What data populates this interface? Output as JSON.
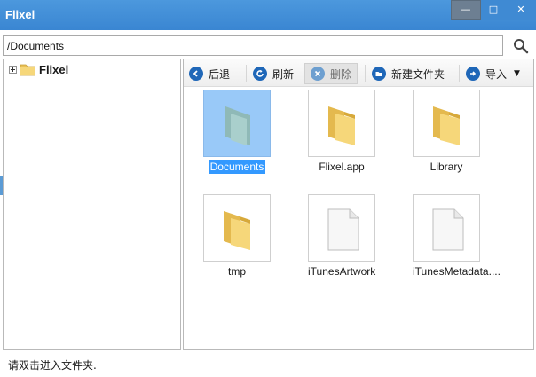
{
  "window": {
    "title": "Flixel",
    "controls": {
      "minimize": "—",
      "maximize": "□",
      "close": "✕"
    }
  },
  "address": {
    "value": "/Documents"
  },
  "tree": {
    "root_label": "Flixel"
  },
  "toolbar": {
    "back": "后退",
    "refresh": "刷新",
    "delete": "删除",
    "new_folder": "新建文件夹",
    "import": "导入"
  },
  "items": [
    {
      "name": "Documents",
      "type": "folder",
      "selected": true
    },
    {
      "name": "Flixel.app",
      "type": "folder"
    },
    {
      "name": "Library",
      "type": "folder"
    },
    {
      "name": "tmp",
      "type": "folder"
    },
    {
      "name": "iTunesArtwork",
      "type": "file"
    },
    {
      "name": "iTunesMetadata....",
      "type": "file"
    }
  ],
  "status": {
    "text": "请双击进入文件夹."
  },
  "colors": {
    "titlebar": "#3a86d2",
    "selection": "#3399ff",
    "folder": "#f2cf6d"
  }
}
